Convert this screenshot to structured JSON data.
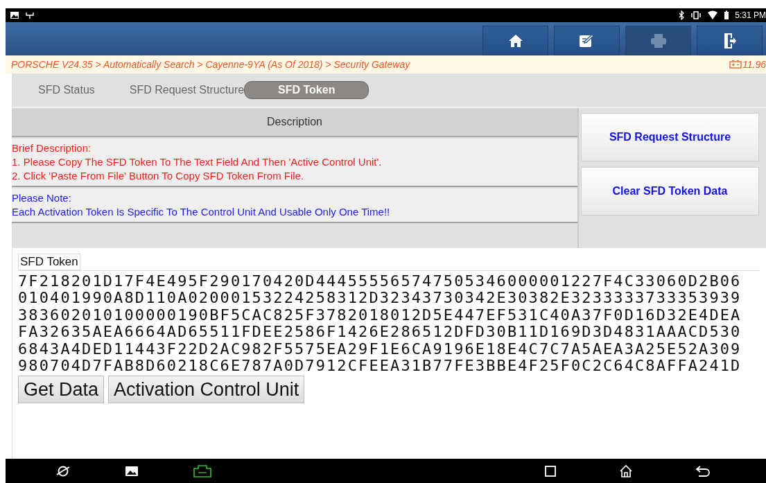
{
  "status_bar": {
    "time": "5:31 PM"
  },
  "toolbar": {
    "buttons": [
      {
        "kind": "home",
        "disabled": false
      },
      {
        "kind": "edit",
        "disabled": false
      },
      {
        "kind": "print",
        "disabled": true
      },
      {
        "kind": "exit",
        "disabled": false
      }
    ]
  },
  "breadcrumb": {
    "path": "PORSCHE V24.35 > Automatically Search > Cayenne-9YA (As Of 2018) > Security Gateway",
    "voltage": "11.96"
  },
  "tabs": [
    {
      "label": "SFD Status",
      "selected": false
    },
    {
      "label": "SFD Request Structure",
      "selected": false
    },
    {
      "label": "SFD Token",
      "selected": true
    }
  ],
  "description": {
    "header": "Description",
    "rows": [
      {
        "color": "#ff1a1a",
        "lines": [
          "Brief Description:",
          "1. Please Copy The SFD Token To The Text Field And Then 'Active Control Unit'.",
          "2. Click 'Paste From File' Button To Copy SFD Token From File."
        ]
      },
      {
        "color": "#1a1aff",
        "lines": [
          "Please Note:",
          "Each Activation Token Is Specific To The Control Unit And Usable Only One Time!!"
        ]
      }
    ]
  },
  "side_buttons": [
    "SFD Request Structure",
    "Clear SFD Token Data"
  ],
  "token_field": {
    "label": "SFD Token",
    "lines": [
      "7F218201D17F4E495F290170420D444555565747505346000001227F4C33060D2B06",
      "010401990A8D110A02000153224258312D32343730342E30382E3233333733353939",
      "383602010100000190BF5CAC825F3782018012D5E447EF531C40A37F0D16D32E4DEA",
      "FA32635AEA6664AD65511FDEE2586F1426E286512DFD30B11D169D3D4831AAACD530",
      "6843A4DED11443F22D2AC982F5575EA29F1E6CA9196E18E4C7C7A5AEA3A25E52A309",
      "980704D7FAB8D60218C6E787A0D7912CFEEA31B77FE3BBE4F25F0C2C64C8AFFA241D"
    ]
  },
  "action_buttons": [
    "Get Data",
    "Activation Control Unit"
  ]
}
